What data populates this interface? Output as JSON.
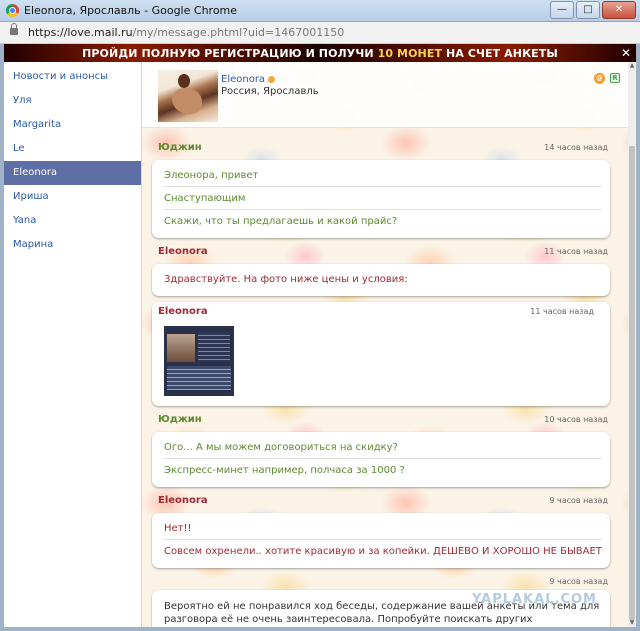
{
  "window": {
    "title": "Eleonora, Ярославль - Google Chrome",
    "min_label": "—",
    "max_label": "□",
    "close_label": "✕"
  },
  "address": {
    "url_host": "https://love.mail.ru",
    "url_path": "/my/message.phtml?uid=1467001150"
  },
  "banner": {
    "text_before": "ПРОЙДИ ПОЛНУЮ РЕГИСТРАЦИЮ И ПОЛУЧИ ",
    "text_highlight": "10 МОНЕТ",
    "text_after": " НА СЧЕТ АНКЕТЫ",
    "close_label": "✕"
  },
  "sidebar": {
    "items": [
      {
        "label": "Новости и анонсы"
      },
      {
        "label": "Уля"
      },
      {
        "label": "Margarita"
      },
      {
        "label": "Le"
      },
      {
        "label": "Eleonora",
        "active": true
      },
      {
        "label": "Ириша"
      },
      {
        "label": "Yana"
      },
      {
        "label": "Марина"
      }
    ]
  },
  "contact": {
    "name": "Eleonora",
    "location": "Россия, Ярославль",
    "mailru_badge": "@",
    "rss_badge": "R"
  },
  "messages": [
    {
      "author": "Юджин",
      "time": "14 часов назад",
      "lines": [
        "Элеонора, привет",
        "Снаступающим",
        "Скажи, что ты предлагаешь и какой прайс?"
      ]
    },
    {
      "author": "Eleonora",
      "time": "11 часов назад",
      "lines": [
        "Здравствуйте. На фото ниже цены и условия:"
      ]
    },
    {
      "author": "Eleonora",
      "time": "11 часов назад"
    },
    {
      "author": "Юджин",
      "time": "10 часов назад",
      "lines": [
        "Ого... А мы можем договориться на скидку?",
        "Экспресс-минет например, полчаса за 1000 ?"
      ]
    },
    {
      "author": "Eleonora",
      "time": "9 часов назад",
      "lines": [
        "Нет!!",
        "Совсем охренели.. хотите красивую и за копейки. ДЕШЕВО И ХОРОШО НЕ БЫВАЕТ"
      ]
    }
  ],
  "system_notice": {
    "time": "9 часов назад",
    "text": "Вероятно ей не понравился ход беседы, содержание вашей анкеты или тема для разговора её не очень заинтересовала. Попробуйте поискать других пользователей, внимательно изучите их пожелания, описанные в анкетах, или постарайтесь найти другие темы для начала разговора"
  },
  "watermark": "YAPLAKAL.COM"
}
